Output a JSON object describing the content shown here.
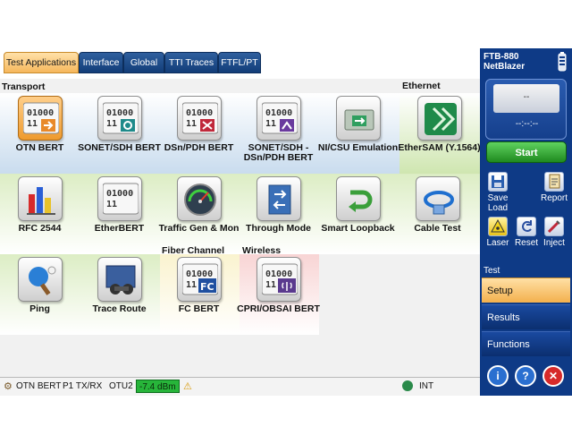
{
  "tabs": [
    "Test Applications",
    "Interface",
    "Global",
    "TTI Traces",
    "FTFL/PT"
  ],
  "sections": {
    "transport": "Transport",
    "ethernet": "Ethernet",
    "fiber_channel": "Fiber Channel",
    "wireless": "Wireless"
  },
  "tiles": {
    "otn_bert": "OTN BERT",
    "sonet_sdh_bert": "SONET/SDH BERT",
    "dsn_pdh_bert": "DSn/PDH BERT",
    "sonet_dsn_bert": "SONET/SDH - DSn/PDH BERT",
    "ni_csu": "NI/CSU Emulation",
    "ethersam": "EtherSAM (Y.1564)",
    "rfc2544": "RFC 2544",
    "etherbert": "EtherBERT",
    "traffic_gen": "Traffic Gen & Mon",
    "through_mode": "Through Mode",
    "smart_loopback": "Smart Loopback",
    "cable_test": "Cable Test",
    "ping": "Ping",
    "trace_route": "Trace Route",
    "fc_bert": "FC BERT",
    "cpri_bert": "CPRI/OBSAI BERT"
  },
  "icon_text": {
    "bits_top": "01000",
    "bits_bottom": "11",
    "fc": "FC"
  },
  "status": {
    "test": "OTN BERT",
    "port": "P1 TX/RX",
    "signal": "OTU2",
    "power": "-7.4 dBm",
    "clock": "INT"
  },
  "panel": {
    "device": "FTB-880",
    "device_name": "NetBlazer",
    "display_value": "--",
    "display_time": "--:--:--",
    "start": "Start",
    "save_load": "Save Load",
    "report": "Report",
    "laser": "Laser",
    "reset": "Reset",
    "inject": "Inject",
    "test_header": "Test",
    "menu": [
      "Setup",
      "Results",
      "Functions"
    ],
    "info": "i",
    "help": "?",
    "close": "✕"
  },
  "colors": {
    "panel_bg": "#0e3a86",
    "tab_active": "#f6b75c",
    "band_blue": "#cfe0f1",
    "band_green": "#d5e9b8",
    "band_yellow": "#f6f0c8",
    "band_pink": "#f7d6d6",
    "start_green": "#2f9f2f",
    "power_bg": "#27b53a"
  }
}
